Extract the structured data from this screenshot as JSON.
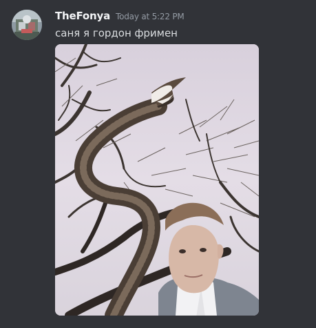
{
  "message": {
    "username": "TheFonya",
    "timestamp": "Today at 5:22 PM",
    "content": "саня я гордон фримен"
  },
  "avatar": {
    "icon": "user-avatar"
  },
  "attachment": {
    "icon": "photo-attachment"
  },
  "colors": {
    "background": "#313338",
    "username": "#f2f3f5",
    "timestamp": "#949ba4",
    "text": "#dbdee1"
  }
}
